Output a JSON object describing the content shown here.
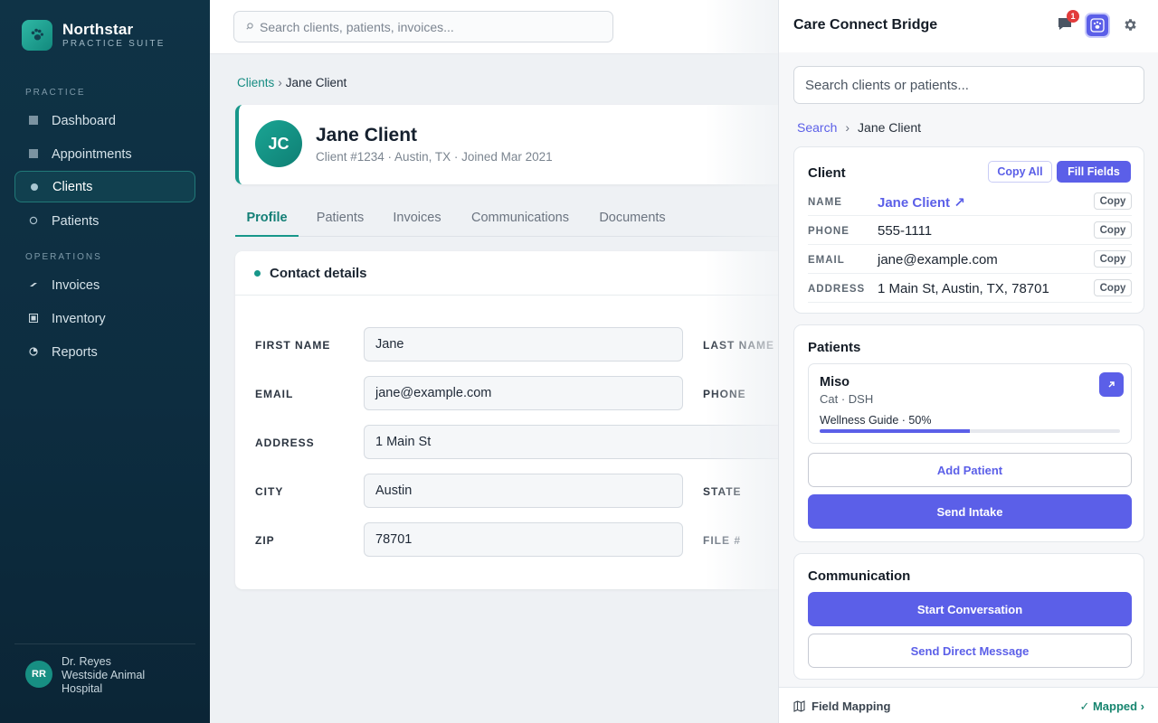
{
  "brand": {
    "name": "Northstar",
    "subtitle": "PRACTICE SUITE"
  },
  "sidebar": {
    "section_practice": "PRACTICE",
    "section_operations": "OPERATIONS",
    "items": [
      {
        "label": "Dashboard"
      },
      {
        "label": "Appointments"
      },
      {
        "label": "Clients",
        "active": true
      },
      {
        "label": "Patients"
      },
      {
        "label": "Invoices"
      },
      {
        "label": "Inventory"
      },
      {
        "label": "Reports"
      }
    ],
    "user": {
      "initials": "RR",
      "name": "Dr. Reyes",
      "org_line1": "Westside Animal",
      "org_line2": "Hospital"
    }
  },
  "topbar": {
    "search_placeholder": "Search clients, patients, invoices..."
  },
  "main": {
    "breadcrumb": {
      "parent": "Clients",
      "current": "Jane Client"
    },
    "client": {
      "initials": "JC",
      "name": "Jane Client",
      "meta": "Client #1234 · Austin, TX · Joined Mar 2021"
    },
    "tabs": [
      "Profile",
      "Patients",
      "Invoices",
      "Communications",
      "Documents"
    ],
    "details": {
      "title": "Contact details",
      "first_name_label": "FIRST NAME",
      "first_name": "Jane",
      "last_name_label": "LAST NAME",
      "email_label": "EMAIL",
      "email": "jane@example.com",
      "phone_label": "PHONE",
      "address_label": "ADDRESS",
      "address": "1 Main St",
      "city_label": "CITY",
      "city": "Austin",
      "state_label": "STATE",
      "zip_label": "ZIP",
      "zip": "78701",
      "file_label": "FILE #"
    }
  },
  "panel": {
    "title": "Care Connect Bridge",
    "notification_count": "1",
    "search_placeholder": "Search clients or patients...",
    "breadcrumb": {
      "parent": "Search",
      "current": "Jane Client"
    },
    "client_card": {
      "title": "Client",
      "copy_all": "Copy All",
      "fill_fields": "Fill Fields",
      "copy_label": "Copy",
      "rows": [
        {
          "key": "NAME",
          "value": "Jane Client ↗"
        },
        {
          "key": "PHONE",
          "value": "555-1111"
        },
        {
          "key": "EMAIL",
          "value": "jane@example.com"
        },
        {
          "key": "ADDRESS",
          "value": "1 Main St, Austin, TX, 78701"
        }
      ]
    },
    "patients_card": {
      "title": "Patients",
      "patient": {
        "name": "Miso",
        "info": "Cat · DSH",
        "progress_label": "Wellness Guide · 50%",
        "progress": 0.5
      },
      "add_patient": "Add Patient",
      "send_intake": "Send Intake"
    },
    "communication_card": {
      "title": "Communication",
      "start_conversation": "Start Conversation",
      "send_direct_message": "Send Direct Message"
    },
    "footer": {
      "field_mapping": "Field Mapping",
      "mapped": "✓ Mapped ›"
    }
  },
  "colors": {
    "accent_teal": "#17978a",
    "accent_indigo": "#5b5fe8",
    "sidebar_bg": "#0f3346"
  }
}
